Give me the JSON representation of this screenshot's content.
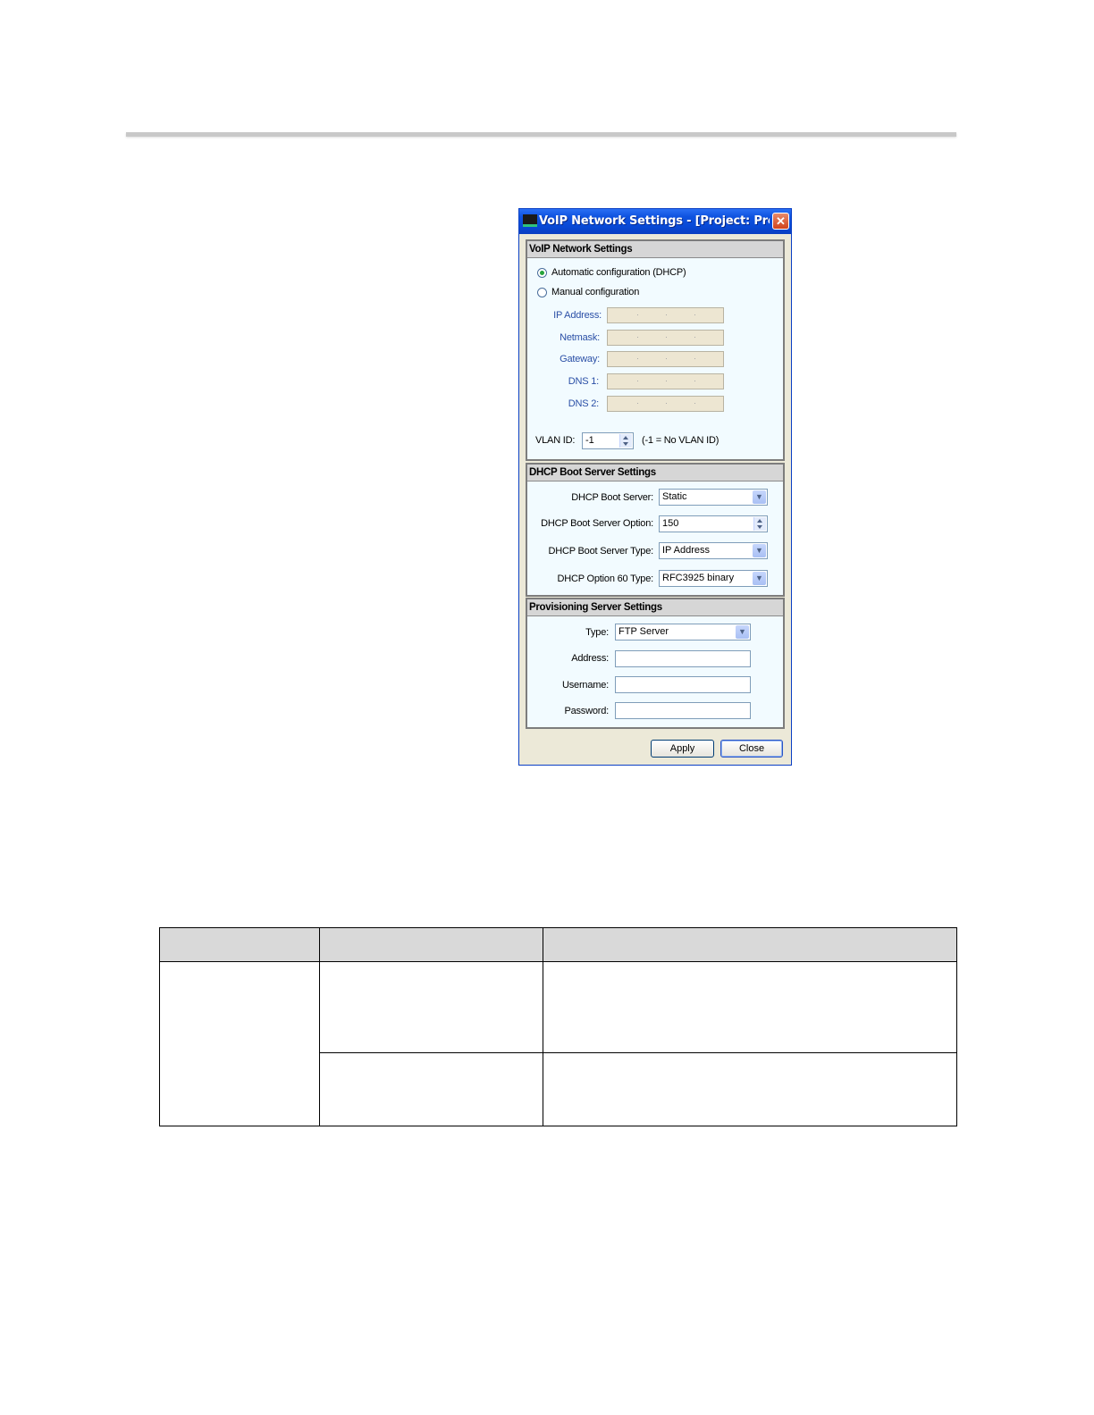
{
  "dialog": {
    "title": "VoIP Network Settings - [Project: Project...",
    "close_symbol": "✕",
    "voip_section": {
      "header": "VoIP Network Settings",
      "radio_auto": "Automatic configuration (DHCP)",
      "radio_manual": "Manual configuration",
      "selected": "auto",
      "fields": {
        "ip_address": "IP Address:",
        "netmask": "Netmask:",
        "gateway": "Gateway:",
        "dns1": "DNS 1:",
        "dns2": "DNS 2:"
      },
      "vlan_label": "VLAN ID:",
      "vlan_value": "-1",
      "vlan_hint": "(-1 = No VLAN ID)"
    },
    "dhcp_section": {
      "header": "DHCP Boot Server Settings",
      "boot_server_label": "DHCP Boot Server:",
      "boot_server_value": "Static",
      "boot_option_label": "DHCP Boot Server Option:",
      "boot_option_value": "150",
      "boot_type_label": "DHCP Boot Server Type:",
      "boot_type_value": "IP Address",
      "option60_label": "DHCP Option 60 Type:",
      "option60_value": "RFC3925 binary"
    },
    "prov_section": {
      "header": "Provisioning Server Settings",
      "type_label": "Type:",
      "type_value": "FTP Server",
      "address_label": "Address:",
      "address_value": "",
      "username_label": "Username:",
      "username_value": "",
      "password_label": "Password:",
      "password_value": ""
    },
    "buttons": {
      "apply": "Apply",
      "close": "Close"
    }
  }
}
